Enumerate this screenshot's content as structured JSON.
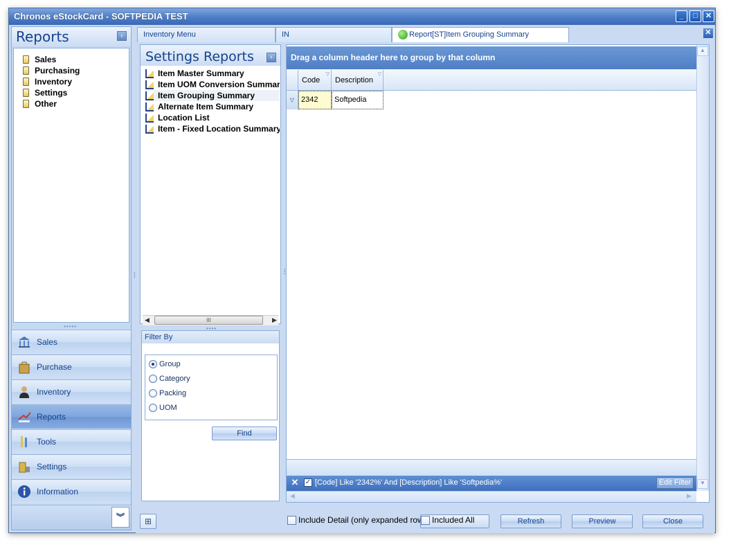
{
  "window": {
    "title": "Chronos eStockCard - SOFTPEDIA TEST",
    "controls": {
      "minimize": "_",
      "maximize": "□",
      "close": "✕"
    }
  },
  "sidebar": {
    "title": "Reports",
    "tree": [
      "Sales",
      "Purchasing",
      "Inventory",
      "Settings",
      "Other"
    ],
    "nav": [
      {
        "label": "Sales",
        "icon": "bank-icon"
      },
      {
        "label": "Purchase",
        "icon": "shopping-bag-icon"
      },
      {
        "label": "Inventory",
        "icon": "person-icon"
      },
      {
        "label": "Reports",
        "icon": "report-chart-icon",
        "active": true
      },
      {
        "label": "Tools",
        "icon": "tools-icon"
      },
      {
        "label": "Settings",
        "icon": "settings-icon"
      },
      {
        "label": "Information",
        "icon": "info-icon"
      }
    ],
    "more_glyph": "»"
  },
  "tabs": [
    {
      "label": "Inventory Menu"
    },
    {
      "label": "IN"
    },
    {
      "label": "Report[ST]Item Grouping Summary",
      "active": true
    }
  ],
  "tab_close": "✕",
  "reports_list": {
    "title": "Settings Reports",
    "items": [
      "Item Master Summary",
      "Item UOM Conversion Summary",
      "Item Grouping Summary",
      "Alternate Item Summary",
      "Location List",
      "Item - Fixed Location Summary"
    ],
    "scroll_thumb": "III"
  },
  "filter_by": {
    "title": "Filter By",
    "options": [
      "Group",
      "Category",
      "Packing",
      "UOM"
    ],
    "selected": "Group",
    "find_label": "Find"
  },
  "grid": {
    "group_panel_text": "Drag a column header here to group by that column",
    "columns": [
      "Code",
      "Description"
    ],
    "rows": [
      {
        "code": "2342",
        "description": "Softpedia"
      }
    ],
    "filter_expression": "[Code] Like '2342%' And [Description] Like 'Softpedia%'",
    "edit_filter_label": "Edit Filter"
  },
  "bottom": {
    "include_detail_label": "Include Detail (only expanded row)",
    "included_all_label": "Included All",
    "refresh_label": "Refresh",
    "preview_label": "Preview",
    "close_label": "Close"
  },
  "colors": {
    "accent": "#15428b",
    "panel": "#c9daf2",
    "group_panel": "#5a8bd0",
    "titlebar": "#4c7cc7"
  }
}
